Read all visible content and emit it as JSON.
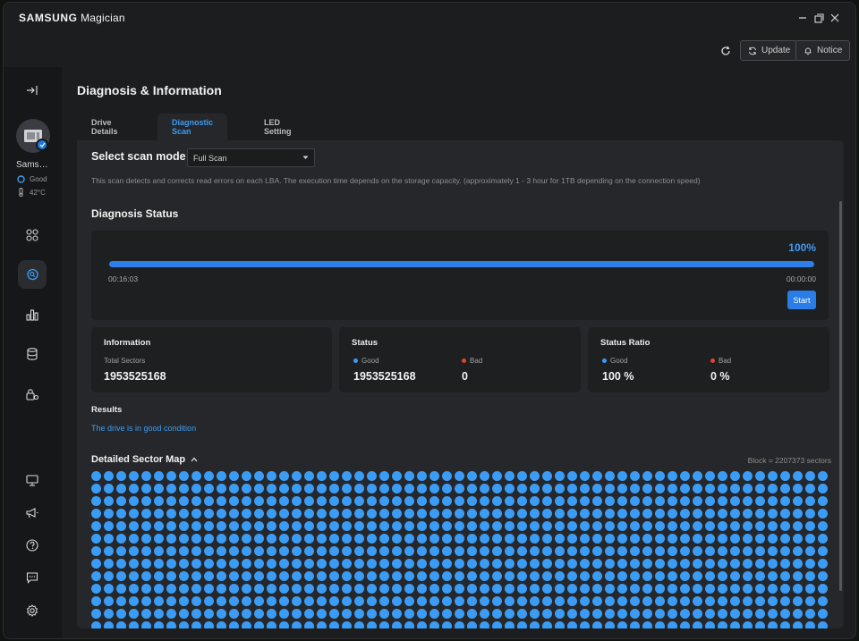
{
  "app": {
    "brand_bold": "SAMSUNG",
    "brand_light": "Magician"
  },
  "window_controls": [
    "minimize-icon",
    "restore-icon",
    "close-icon"
  ],
  "top_actions": {
    "refresh_icon": "refresh-icon",
    "update_label": "Update",
    "notice_label": "Notice"
  },
  "sidebar": {
    "drive_name": "Samsung",
    "drive_health": "Good",
    "drive_temp": "42°C",
    "nav_icons": [
      "collapse-icon",
      "dashboard-icon",
      "diagnosis-icon",
      "benchmark-icon",
      "data-management-icon",
      "security-icon"
    ],
    "bottom_icons": [
      "display-icon",
      "announce-icon",
      "help-icon",
      "feedback-icon",
      "settings-icon"
    ]
  },
  "page": {
    "title": "Diagnosis & Information",
    "tabs": [
      {
        "label": "Drive Details"
      },
      {
        "label": "Diagnostic Scan"
      },
      {
        "label": "LED Setting"
      }
    ]
  },
  "scan": {
    "mode_label": "Select scan mode",
    "mode_value": "Full Scan",
    "description": "This scan detects and corrects read errors on each LBA. The execution time depends on the storage capacity. (approximately 1 - 3 hour for 1TB depending on the connection speed)"
  },
  "diagnosis": {
    "title": "Diagnosis Status",
    "progress_text": "100%",
    "progress_fraction": 1.0,
    "elapsed": "00:16:03",
    "remaining": "00:00:00",
    "start_label": "Start"
  },
  "information": {
    "title": "Information",
    "total_sectors_label": "Total Sectors",
    "total_sectors_value": "1953525168"
  },
  "status": {
    "title": "Status",
    "good_label": "Good",
    "good_value": "1953525168",
    "bad_label": "Bad",
    "bad_value": "0"
  },
  "ratio": {
    "title": "Status Ratio",
    "good_label": "Good",
    "good_value": "100 %",
    "bad_label": "Bad",
    "bad_value": "0 %"
  },
  "results": {
    "label": "Results",
    "text": "The drive is in good condition"
  },
  "sector_map": {
    "title": "Detailed Sector Map",
    "block_info": "Block = 2207373 sectors",
    "columns": 59,
    "rows": 13,
    "cell_status": "good"
  },
  "colors": {
    "accent": "#3b9cf5",
    "good": "#3b9cf5",
    "bad": "#e0452f",
    "background": "#1c1d1f"
  }
}
